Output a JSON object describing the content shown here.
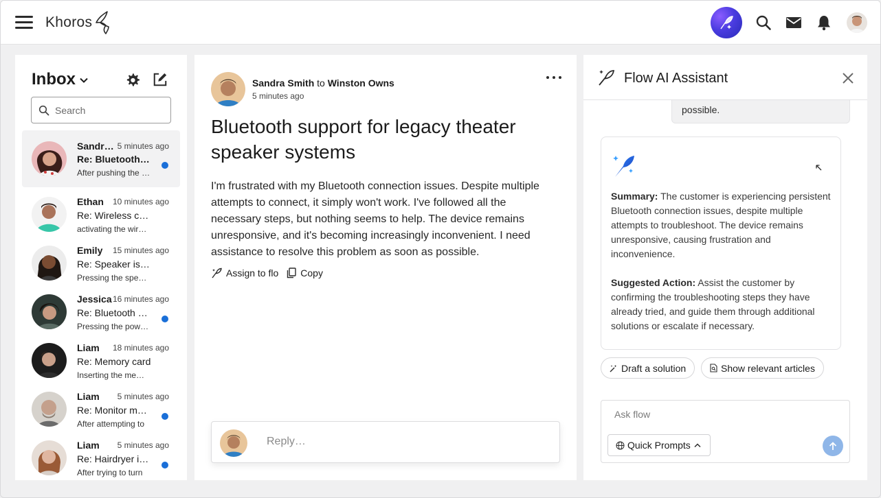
{
  "app": {
    "brand": "Khoros",
    "icons": [
      "menu-icon",
      "flow-ai-icon",
      "search-icon",
      "mail-icon",
      "bell-icon",
      "user-avatar"
    ]
  },
  "inbox": {
    "title": "Inbox",
    "search_placeholder": "Search",
    "messages": [
      {
        "name": "Sandra Smith",
        "time": "5 minutes ago",
        "subject": "Re: Bluetooth support",
        "preview": "After pushing the button",
        "unread": true,
        "selected": true
      },
      {
        "name": "Ethan",
        "time": "10 minutes ago",
        "subject": "Re: Wireless charger",
        "preview": "activating the wireless",
        "unread": false,
        "selected": false
      },
      {
        "name": "Emily",
        "time": "15 minutes ago",
        "subject": "Re: Speaker issue",
        "preview": "Pressing the speaker",
        "unread": false,
        "selected": false
      },
      {
        "name": "Jessica",
        "time": "16 minutes ago",
        "subject": "Re: Bluetooth pairing",
        "preview": "Pressing the power button",
        "unread": true,
        "selected": false
      },
      {
        "name": "Liam",
        "time": "18 minutes ago",
        "subject": "Re: Memory card",
        "preview": "Inserting the memory card",
        "unread": false,
        "selected": false
      },
      {
        "name": "Liam",
        "time": "5 minutes ago",
        "subject": "Re: Monitor mount",
        "preview": "After attempting to",
        "unread": true,
        "selected": false
      },
      {
        "name": "Liam",
        "time": "5 minutes ago",
        "subject": "Re: Hairdryer issue",
        "preview": "After trying to turn",
        "unread": true,
        "selected": false
      }
    ]
  },
  "conversation": {
    "from": "Sandra Smith",
    "to_word": "to",
    "to": "Winston Owns",
    "time": "5 minutes ago",
    "title": "Bluetooth support for legacy theater speaker systems",
    "body": "I'm frustrated with my Bluetooth connection issues. Despite multiple attempts to connect, it simply won't work. I've followed all the necessary steps, but nothing seems to help. The device remains unresponsive, and it's becoming increasingly inconvenient. I need assistance to resolve this problem as soon as possible.",
    "assign_label": "Assign to flo",
    "copy_label": "Copy",
    "reply_placeholder": "Reply…"
  },
  "assistant": {
    "title": "Flow AI Assistant",
    "previous_message_tail": "possible.",
    "summary_label": "Summary:",
    "summary_text": "The customer is experiencing persistent Bluetooth connection issues, despite multiple attempts to troubleshoot. The device remains unresponsive, causing frustration and inconvenience.",
    "action_label": "Suggested Action:",
    "action_text": "Assist the customer by confirming the troubleshooting steps they have already tried, and guide them through additional solutions or escalate if necessary.",
    "draft_label": "Draft a solution",
    "articles_label": "Show relevant articles",
    "ask_placeholder": "Ask flow",
    "quick_prompts_label": "Quick Prompts"
  },
  "colors": {
    "accent_blue": "#1a6fd8",
    "send_button": "#8fb6e8",
    "ai_orb": "#4a3ce0"
  }
}
